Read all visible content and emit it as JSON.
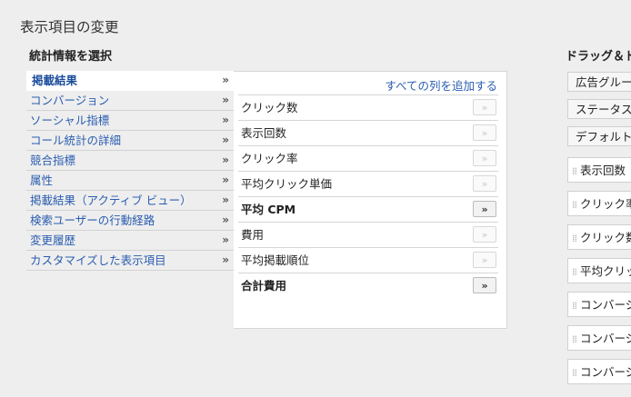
{
  "page_title": "表示項目の変更",
  "section_title": "統計情報を選択",
  "categories": [
    {
      "label": "掲載結果",
      "active": true
    },
    {
      "label": "コンバージョン"
    },
    {
      "label": "ソーシャル指標"
    },
    {
      "label": "コール統計の詳細"
    },
    {
      "label": "競合指標"
    },
    {
      "label": "属性"
    },
    {
      "label": "掲載結果（アクティブ ビュー）"
    },
    {
      "label": "検索ユーザーの行動経路"
    },
    {
      "label": "変更履歴"
    },
    {
      "label": "カスタマイズした表示項目"
    }
  ],
  "chevron": "»",
  "add_all_label": "すべての列を追加する",
  "metrics": [
    {
      "label": "クリック数",
      "enabled": false
    },
    {
      "label": "表示回数",
      "enabled": false
    },
    {
      "label": "クリック率",
      "enabled": false
    },
    {
      "label": "平均クリック単価",
      "enabled": false
    },
    {
      "label": "平均 CPM",
      "enabled": true
    },
    {
      "label": "費用",
      "enabled": false
    },
    {
      "label": "平均掲載順位",
      "enabled": false
    },
    {
      "label": "合計費用",
      "enabled": true
    }
  ],
  "right_panel": {
    "title": "ドラッグ＆ドロ",
    "fixed_columns": [
      "広告グルー",
      "ステータス",
      "デフォルトの"
    ],
    "columns": [
      "表示回数",
      "クリック率",
      "クリック数",
      "平均クリッ",
      "コンバージ",
      "コンバージ",
      "コンバージ"
    ]
  },
  "icons": {
    "chevron": "double-chevron-right-icon",
    "grip": "drag-handle-icon"
  }
}
